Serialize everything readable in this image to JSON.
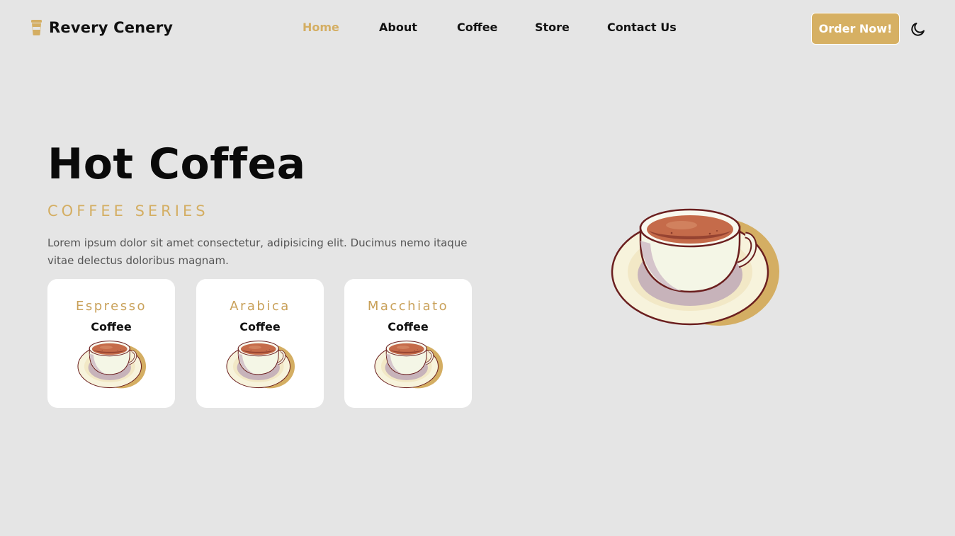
{
  "brand": {
    "name": "Revery Cenery",
    "icon": "coffee-cup-icon"
  },
  "nav": {
    "items": [
      {
        "label": "Home",
        "active": true
      },
      {
        "label": "About",
        "active": false
      },
      {
        "label": "Coffee",
        "active": false
      },
      {
        "label": "Store",
        "active": false
      },
      {
        "label": "Contact Us",
        "active": false
      }
    ]
  },
  "header": {
    "order_label": "Order Now!",
    "theme_icon": "moon-icon"
  },
  "hero": {
    "title": "Hot Coffea",
    "subtitle": "COFFEE SERIES",
    "description": "Lorem ipsum dolor sit amet consectetur, adipisicing elit. Ducimus nemo itaque vitae delectus doloribus magnam.",
    "image_icon": "coffee-cup-illustration"
  },
  "cards": [
    {
      "name": "Espresso",
      "type": "Coffee",
      "icon": "coffee-cup-illustration"
    },
    {
      "name": "Arabica",
      "type": "Coffee",
      "icon": "coffee-cup-illustration"
    },
    {
      "name": "Macchiato",
      "type": "Coffee",
      "icon": "coffee-cup-illustration"
    }
  ],
  "colors": {
    "background": "#e5e5e5",
    "accent": "#d6b063",
    "card": "#ffffff",
    "text": "#111111"
  }
}
